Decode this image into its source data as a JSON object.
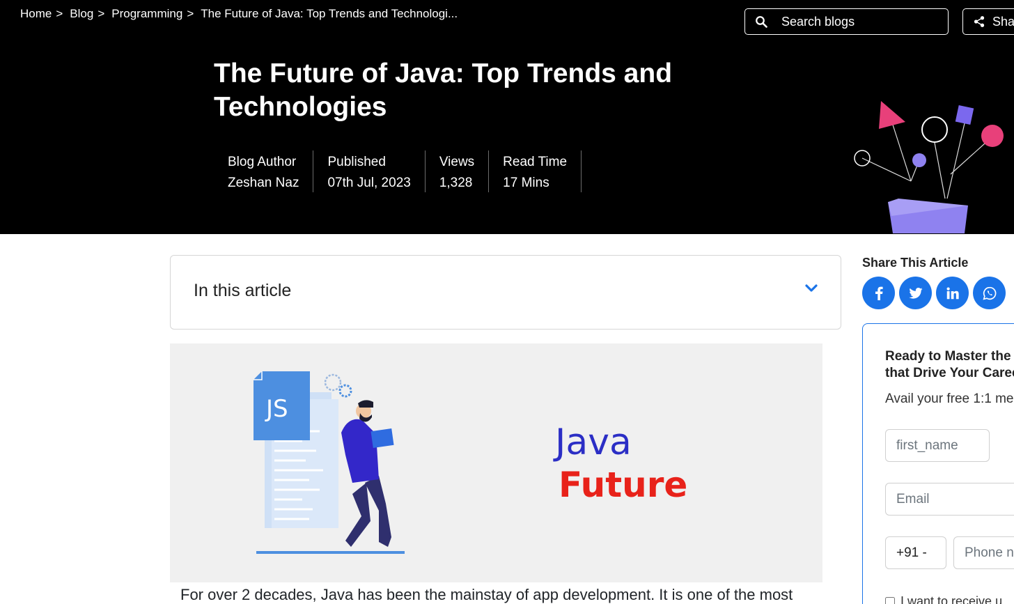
{
  "breadcrumb": {
    "items": [
      "Home",
      "Blog",
      "Programming"
    ],
    "separator": ">",
    "current": "The Future of Java: Top Trends and Technologi..."
  },
  "search": {
    "placeholder": "Search blogs",
    "icon": "search-icon"
  },
  "share_top": {
    "label": "Sha",
    "icon": "share-icon"
  },
  "title": "The Future of Java: Top Trends and Technologies",
  "meta": [
    {
      "key": "Blog Author",
      "value": "Zeshan Naz"
    },
    {
      "key": "Published",
      "value": "07th Jul, 2023"
    },
    {
      "key": "Views",
      "value": "1,328"
    },
    {
      "key": "Read Time",
      "value": "17 Mins"
    }
  ],
  "toc": {
    "label": "In this article",
    "icon": "chevron-down-icon"
  },
  "article_image": {
    "icon_label": "JS",
    "word1": "Java",
    "word2": "Future"
  },
  "article_text": "For over 2 decades, Java has been the mainstay of app development. It is one of the most",
  "share_article": {
    "title": "Share This Article",
    "icons": [
      "facebook-icon",
      "twitter-icon",
      "linkedin-icon",
      "whatsapp-icon"
    ]
  },
  "lead_form": {
    "title_line1": "Ready to Master the",
    "title_line2": "that Drive Your Caree",
    "subtitle": "Avail your free 1:1 me",
    "first_name_placeholder": "first_name",
    "email_placeholder": "Email",
    "country_code": "+91 -",
    "phone_placeholder": "Phone n",
    "consent": "I want to receive u"
  },
  "colors": {
    "header_bg": "#000000",
    "accent_blue": "#1a73e8",
    "java_blue": "#2b2ec5",
    "future_red": "#e8221a",
    "illustration_purple": "#7b68ee"
  }
}
